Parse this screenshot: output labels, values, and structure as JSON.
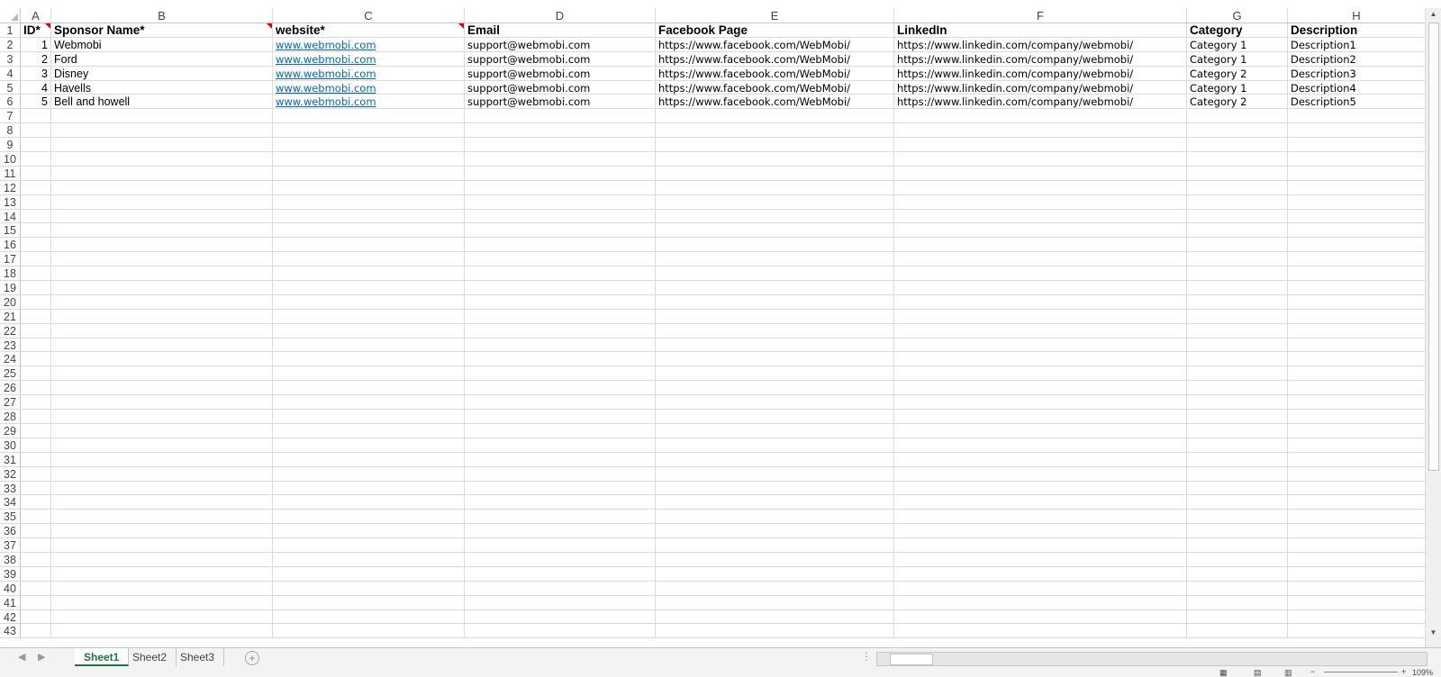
{
  "columns": [
    "A",
    "B",
    "C",
    "D",
    "E",
    "F",
    "G",
    "H"
  ],
  "row_numbers": [
    "1",
    "2",
    "3",
    "4",
    "5",
    "6",
    "7",
    "8",
    "9",
    "10",
    "11",
    "12",
    "13",
    "14",
    "15",
    "16",
    "17",
    "18",
    "19",
    "20",
    "21",
    "22",
    "23",
    "24",
    "25",
    "26",
    "27",
    "28",
    "29",
    "30",
    "31",
    "32",
    "33",
    "34",
    "35",
    "36",
    "37",
    "38",
    "39",
    "40",
    "41",
    "42",
    "43"
  ],
  "headers": {
    "id": "ID*",
    "sponsor_name": "Sponsor Name*",
    "website": "website*",
    "email": "Email",
    "facebook": "Facebook Page",
    "linkedin": "LinkedIn",
    "category": "Category",
    "description": "Description"
  },
  "rows": [
    {
      "id": "1",
      "name": "Webmobi",
      "website": "www.webmobi.com",
      "email": "support@webmobi.com",
      "facebook": "https://www.facebook.com/WebMobi/",
      "linkedin": "https://www.linkedin.com/company/webmobi/",
      "category": "Category 1",
      "description": "Description1"
    },
    {
      "id": "2",
      "name": "Ford",
      "website": "www.webmobi.com",
      "email": "support@webmobi.com",
      "facebook": "https://www.facebook.com/WebMobi/",
      "linkedin": "https://www.linkedin.com/company/webmobi/",
      "category": "Category 1",
      "description": "Description2"
    },
    {
      "id": "3",
      "name": "Disney",
      "website": "www.webmobi.com",
      "email": "support@webmobi.com",
      "facebook": "https://www.facebook.com/WebMobi/",
      "linkedin": "https://www.linkedin.com/company/webmobi/",
      "category": "Category 2",
      "description": "Description3"
    },
    {
      "id": "4",
      "name": "Havells",
      "website": "www.webmobi.com",
      "email": "support@webmobi.com",
      "facebook": "https://www.facebook.com/WebMobi/",
      "linkedin": "https://www.linkedin.com/company/webmobi/",
      "category": "Category 1",
      "description": "Description4"
    },
    {
      "id": "5",
      "name": "Bell and howell",
      "website": "www.webmobi.com",
      "email": "support@webmobi.com",
      "facebook": "https://www.facebook.com/WebMobi/",
      "linkedin": "https://www.linkedin.com/company/webmobi/",
      "category": "Category 2",
      "description": "Description5"
    }
  ],
  "sheets": [
    "Sheet1",
    "Sheet2",
    "Sheet3"
  ],
  "active_sheet": "Sheet1",
  "zoom_label": "109%",
  "colors": {
    "active_tab": "#217346",
    "link": "#0563c1",
    "comment_marker": "#dd0000"
  },
  "icons": {
    "add_sheet": "plus-circle-icon",
    "nav_prev": "triangle-left-icon",
    "nav_next": "triangle-right-icon"
  }
}
